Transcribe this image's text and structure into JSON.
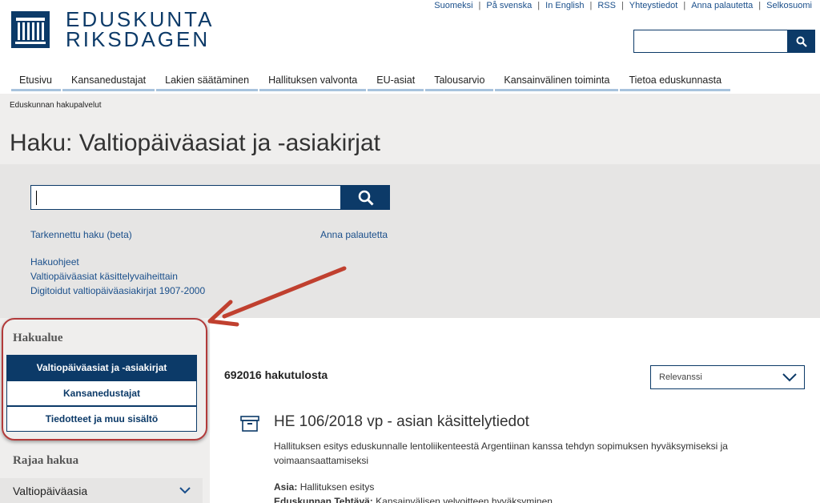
{
  "header": {
    "logo_line1": "EDUSKUNTA",
    "logo_line2": "RIKSDAGEN",
    "top_links": [
      "Suomeksi",
      "På svenska",
      "In English",
      "RSS",
      "Yhteystiedot",
      "Anna palautetta",
      "Selkosuomi"
    ],
    "search_icon": "search-icon"
  },
  "nav": [
    "Etusivu",
    "Kansanedustajat",
    "Lakien säätäminen",
    "Hallituksen valvonta",
    "EU-asiat",
    "Talousarvio",
    "Kansainvälinen toiminta",
    "Tietoa eduskunnasta"
  ],
  "breadcrumb": "Eduskunnan hakupalvelut",
  "page_title": "Haku: Valtiopäiväasiat ja -asiakirjat",
  "search": {
    "value": "",
    "advanced_link": "Tarkennettu haku (beta)",
    "feedback_link": "Anna palautetta",
    "help_links": [
      "Hakuohjeet",
      "Valtiopäiväasiat käsittelyvaiheittain",
      "Digitoidut valtiopäiväasiakirjat 1907-2000"
    ]
  },
  "sidebar": {
    "scope_title": "Hakualue",
    "scope_buttons": [
      "Valtiopäiväasiat ja -asiakirjat",
      "Kansanedustajat",
      "Tiedotteet ja muu sisältö"
    ],
    "refine_title": "Rajaa hakua",
    "filter_label": "Valtiopäiväasia"
  },
  "results": {
    "count_text": "692016 hakutulosta",
    "sort_value": "Relevanssi",
    "first": {
      "icon": "archive-box-icon",
      "title": "HE 106/2018 vp - asian käsittelytiedot",
      "description": "Hallituksen esitys eduskunnalle lentoliikenteestä Argentiinan kanssa tehdyn sopimuksen hyväksymiseksi ja voimaansaattamiseksi",
      "asia_label": "Asia:",
      "asia_value": "Hallituksen esitys",
      "tehtava_label": "Eduskunnan Tehtävä:",
      "tehtava_value": "Kansainvälisen velvoitteen hyväksyminen"
    }
  },
  "colors": {
    "brand": "#0c3a68",
    "link": "#1a4f8b",
    "annotation": "#b23a3a"
  }
}
